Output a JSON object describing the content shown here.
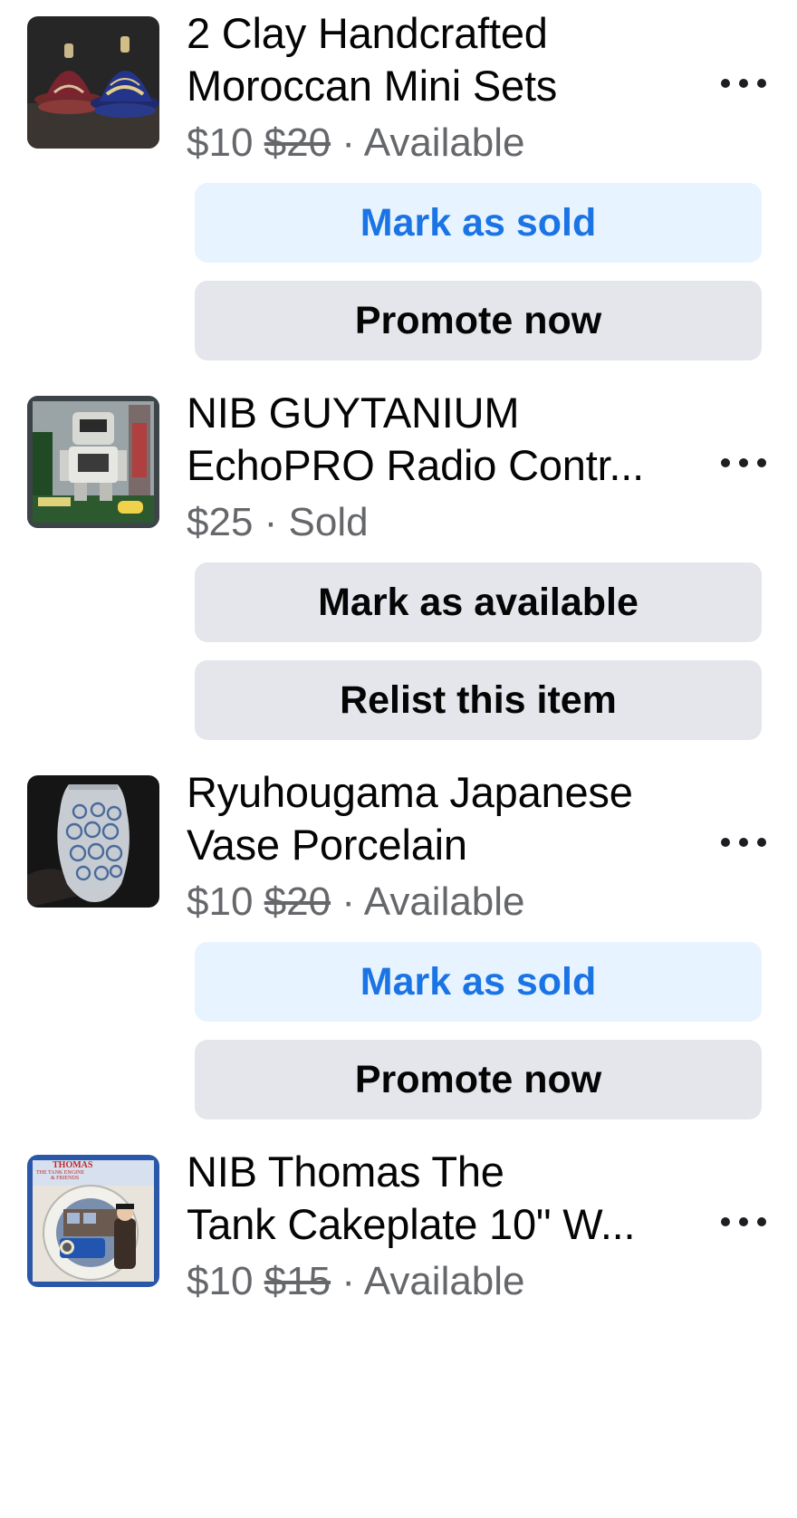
{
  "listings": [
    {
      "title_line1": "2 Clay Handcrafted",
      "title_line2": "Moroccan Mini Sets",
      "price": "$10",
      "original_price": "$20",
      "separator": "·",
      "status": "Available",
      "button1_label": "Mark as sold",
      "button1_style": "primary",
      "button2_label": "Promote now",
      "thumbnail": "moroccan-tagine-photo"
    },
    {
      "title_line1": "NIB GUYTANIUM",
      "title_line2": "EchoPRO Radio Contr...",
      "price": "$25",
      "original_price": "",
      "separator": "·",
      "status": "Sold",
      "button1_label": "Mark as available",
      "button1_style": "secondary",
      "button2_label": "Relist this item",
      "thumbnail": "robot-toy-box-photo"
    },
    {
      "title_line1": "Ryuhougama Japanese",
      "title_line2": "Vase Porcelain",
      "price": "$10",
      "original_price": "$20",
      "separator": "·",
      "status": "Available",
      "button1_label": "Mark as sold",
      "button1_style": "primary",
      "button2_label": "Promote now",
      "thumbnail": "porcelain-vase-photo"
    },
    {
      "title_line1": "NIB Thomas The",
      "title_line2": "Tank Cakeplate 10\" W...",
      "price": "$10",
      "original_price": "$15",
      "separator": "·",
      "status": "Available",
      "thumbnail": "thomas-cakeplate-photo",
      "thumb_text_line1": "THOMAS",
      "thumb_text_line2": "THE TANK ENGINE",
      "thumb_text_line3": "& FRIENDS"
    }
  ],
  "colors": {
    "primary_button_bg": "#e7f3ff",
    "primary_button_text": "#1b74e4",
    "secondary_button_bg": "#e4e6eb",
    "meta_text": "#65676b"
  },
  "icons": {
    "more": "more-options-icon"
  }
}
